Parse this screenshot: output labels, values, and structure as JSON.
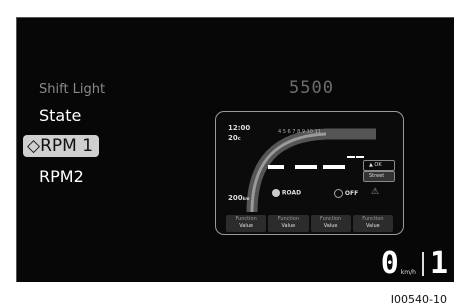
{
  "menu": {
    "title": "Shift Light",
    "items": [
      {
        "label": "State"
      },
      {
        "label": "RPM 1",
        "selected_glyph": "◇"
      },
      {
        "label": "RPM2"
      }
    ]
  },
  "value": "5500",
  "preview": {
    "time": "12:00",
    "temp": "20",
    "temp_unit": "c",
    "lower_value": "200",
    "lower_unit": "km",
    "tach_marks": "4   5   6   7   8   9  10  11",
    "info_ok": "▲ OK",
    "info_mode": "Street",
    "road_label": "ROAD",
    "off_label": "OFF",
    "functions": [
      {
        "title": "Function",
        "value": "Value"
      },
      {
        "title": "Function",
        "value": "Value"
      },
      {
        "title": "Function",
        "value": "Value"
      },
      {
        "title": "Function",
        "value": "Value"
      }
    ]
  },
  "bottom": {
    "speed": "0",
    "unit": "km/h",
    "gear": "1"
  },
  "caption": "I00540-10",
  "colors": {
    "screen_bg": "#070707",
    "selected_bg": "#cfcfcf",
    "muted_text": "#8a8a8a"
  }
}
